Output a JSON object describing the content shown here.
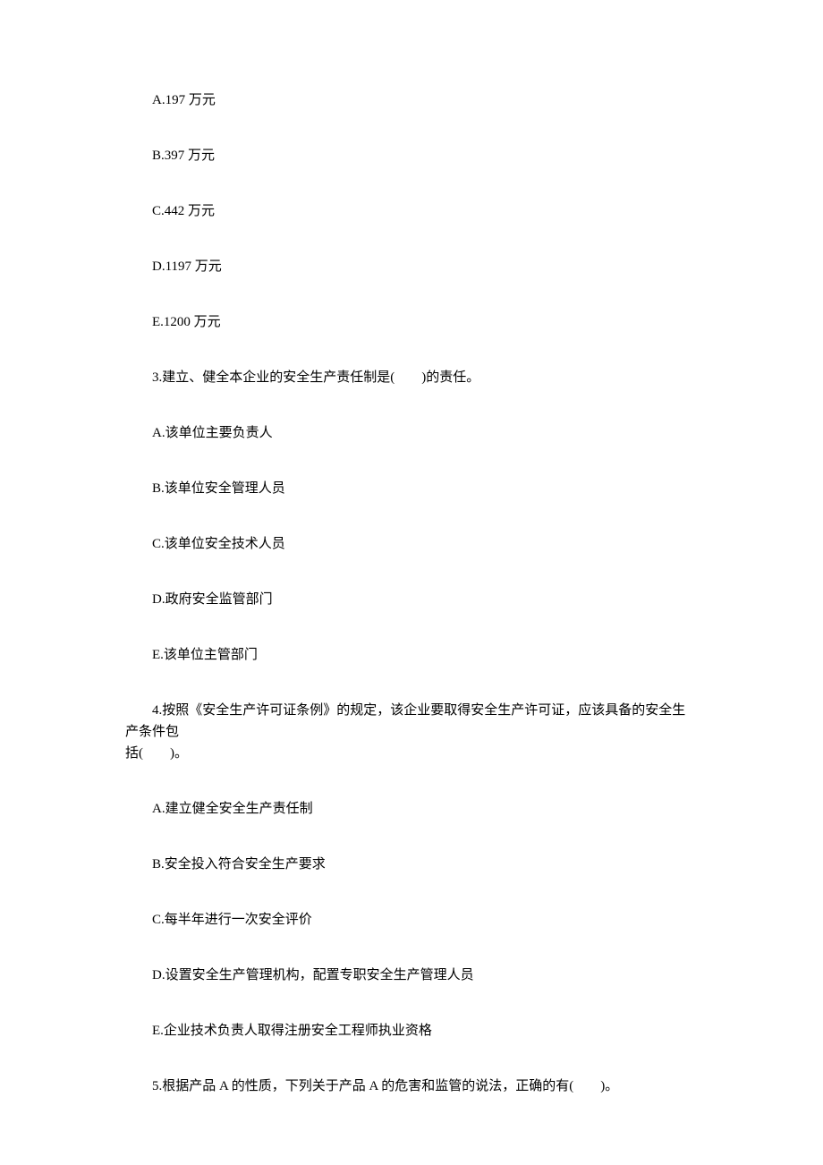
{
  "q2_options": {
    "a": "A.197 万元",
    "b": "B.397 万元",
    "c": "C.442 万元",
    "d": "D.1197 万元",
    "e": "E.1200 万元"
  },
  "q3": {
    "stem": "3.建立、健全本企业的安全生产责任制是(　　)的责任。",
    "a": "A.该单位主要负责人",
    "b": "B.该单位安全管理人员",
    "c": "C.该单位安全技术人员",
    "d": "D.政府安全监管部门",
    "e": "E.该单位主管部门"
  },
  "q4": {
    "stem_line1": "4.按照《安全生产许可证条例》的规定，该企业要取得安全生产许可证，应该具备的安全生产条件包",
    "stem_line2": "括(　　)。",
    "a": "A.建立健全安全生产责任制",
    "b": "B.安全投入符合安全生产要求",
    "c": "C.每半年进行一次安全评价",
    "d": "D.设置安全生产管理机构，配置专职安全生产管理人员",
    "e": "E.企业技术负责人取得注册安全工程师执业资格"
  },
  "q5": {
    "stem": "5.根据产品 A 的性质，下列关于产品 A 的危害和监管的说法，正确的有(　　)。"
  }
}
